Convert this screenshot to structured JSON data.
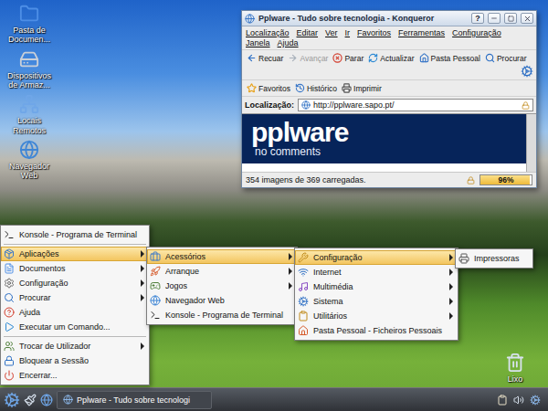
{
  "desktop": {
    "icons": [
      {
        "label": "Pasta de Documen..."
      },
      {
        "label": "Dispositivos de Armaz..."
      },
      {
        "label": "Locais Remotos"
      },
      {
        "label": "Navegador Web"
      }
    ],
    "trash": {
      "label": "Lixo"
    }
  },
  "browser": {
    "title": "Pplware - Tudo sobre tecnologia - Konqueror",
    "help_button": "?",
    "menu": [
      "Localização",
      "Editar",
      "Ver",
      "Ir",
      "Favoritos",
      "Ferramentas",
      "Configuração",
      "Janela",
      "Ajuda"
    ],
    "toolbar": [
      {
        "label": "Recuar",
        "disabled": false
      },
      {
        "label": "Avançar",
        "disabled": true
      },
      {
        "label": "Parar",
        "disabled": false
      },
      {
        "label": "Actualizar",
        "disabled": false
      },
      {
        "label": "Pasta Pessoal",
        "disabled": false
      },
      {
        "label": "Procurar",
        "disabled": false
      }
    ],
    "bookmarks_bar": [
      {
        "label": "Favoritos"
      },
      {
        "label": "Histórico"
      },
      {
        "label": "Imprimir"
      }
    ],
    "location": {
      "label": "Localização:",
      "url": "http://pplware.sapo.pt/"
    },
    "page": {
      "logo": "pplware",
      "tagline": "no comments"
    },
    "status": {
      "text": "354 imagens de 369 carregadas.",
      "progress": {
        "level": 0.96,
        "reading": "96%"
      }
    }
  },
  "k_menu": {
    "items": [
      {
        "label": "Konsole - Programa de Terminal",
        "selected": false,
        "submenu": false,
        "separator_before": false
      },
      {
        "label": "Aplicações",
        "selected": true,
        "submenu": true,
        "separator_before": true
      },
      {
        "label": "Documentos",
        "selected": false,
        "submenu": true,
        "separator_before": false
      },
      {
        "label": "Configuração",
        "selected": false,
        "submenu": true,
        "separator_before": false
      },
      {
        "label": "Procurar",
        "selected": false,
        "submenu": true,
        "separator_before": false
      },
      {
        "label": "Ajuda",
        "selected": false,
        "submenu": false,
        "separator_before": false
      },
      {
        "label": "Executar um Comando...",
        "selected": false,
        "submenu": false,
        "separator_before": false
      },
      {
        "label": "Trocar de Utilizador",
        "selected": false,
        "submenu": true,
        "separator_before": true
      },
      {
        "label": "Bloquear a Sessão",
        "selected": false,
        "submenu": false,
        "separator_before": false
      },
      {
        "label": "Encerrar...",
        "selected": false,
        "submenu": false,
        "separator_before": false
      }
    ]
  },
  "submenus": [
    {
      "items": [
        {
          "label": "Acessórios",
          "selected": true,
          "submenu": true,
          "separator_before": false
        },
        {
          "label": "Arranque",
          "selected": false,
          "submenu": true,
          "separator_before": false
        },
        {
          "label": "Jogos",
          "selected": false,
          "submenu": true,
          "separator_before": false
        },
        {
          "label": "Navegador Web",
          "selected": false,
          "submenu": false,
          "separator_before": false
        },
        {
          "label": "Konsole - Programa de Terminal",
          "selected": false,
          "submenu": false,
          "separator_before": false
        }
      ]
    },
    {
      "items": [
        {
          "label": "Configuração",
          "selected": true,
          "submenu": true,
          "separator_before": false
        },
        {
          "label": "Internet",
          "selected": false,
          "submenu": true,
          "separator_before": false
        },
        {
          "label": "Multimédia",
          "selected": false,
          "submenu": true,
          "separator_before": false
        },
        {
          "label": "Sistema",
          "selected": false,
          "submenu": true,
          "separator_before": false
        },
        {
          "label": "Utilitários",
          "selected": false,
          "submenu": true,
          "separator_before": false
        },
        {
          "label": "Pasta Pessoal - Ficheiros Pessoais",
          "selected": false,
          "submenu": false,
          "separator_before": false
        }
      ]
    },
    {
      "items": [
        {
          "label": "Impressoras",
          "selected": false,
          "submenu": false,
          "separator_before": false
        }
      ]
    }
  ],
  "taskbar": {
    "tasks": [
      {
        "label": "Pplware - Tudo sobre tecnologi",
        "selected": false
      }
    ]
  }
}
